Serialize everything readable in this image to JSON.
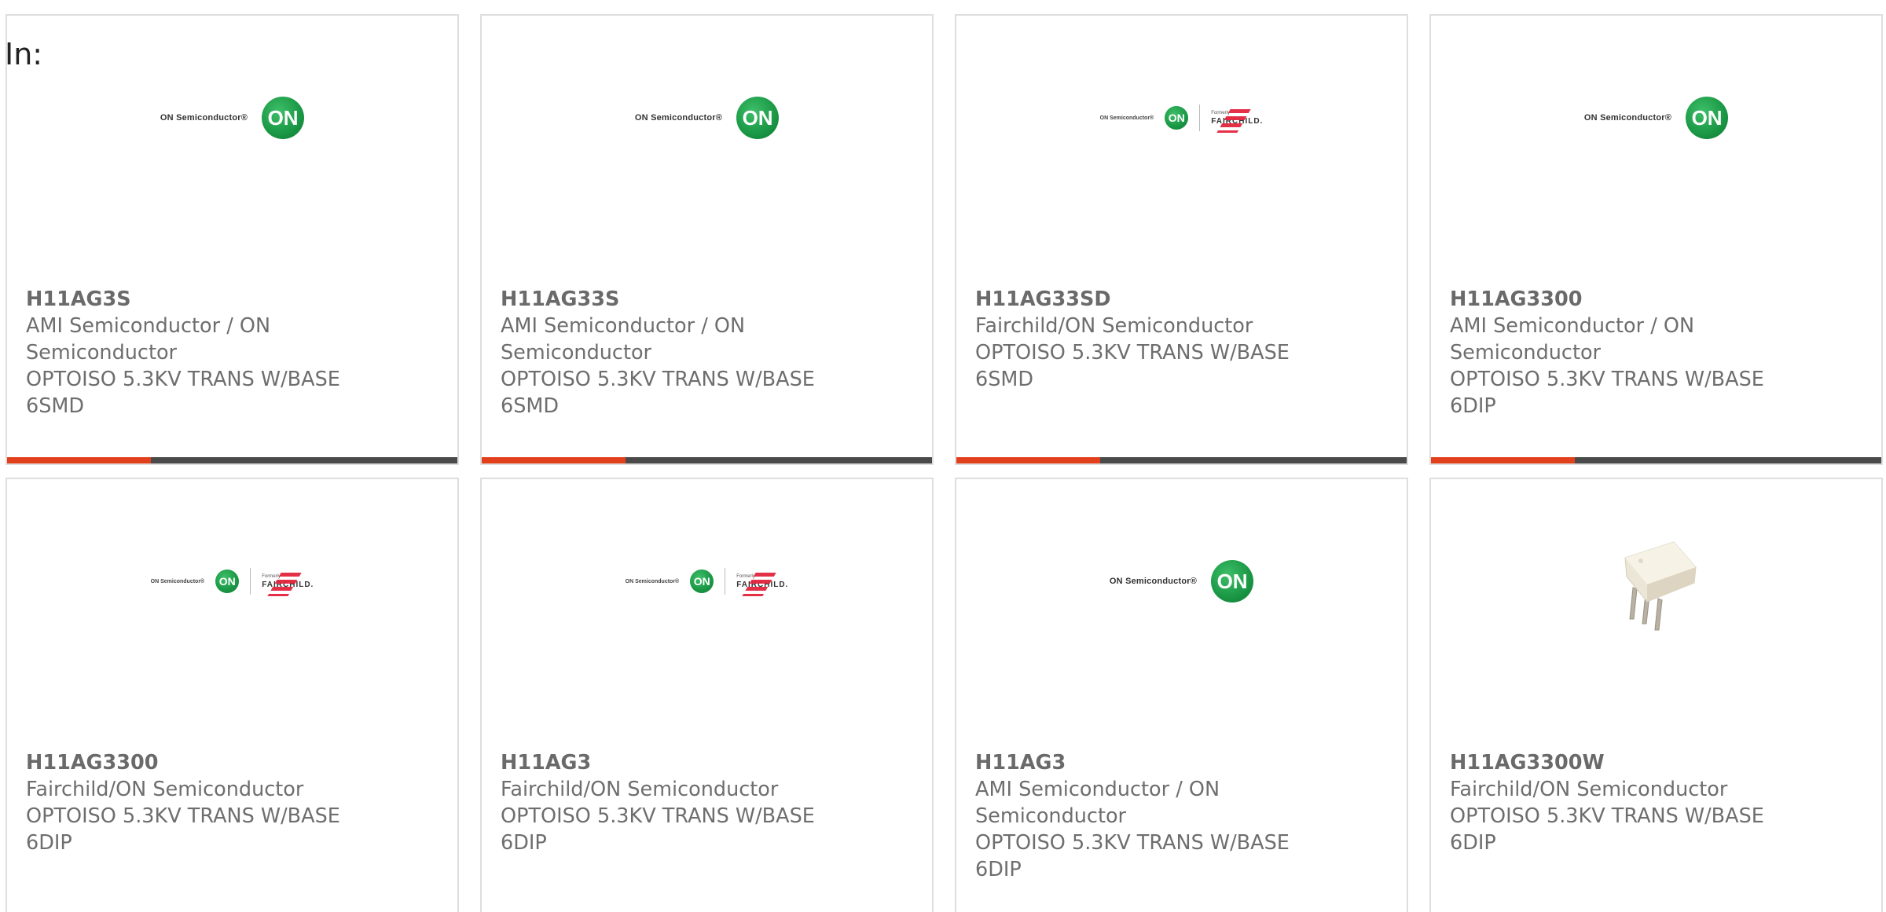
{
  "heading": "In:",
  "colors": {
    "accent_bar": "#e2401c",
    "bar": "#4a4a4a",
    "on_green": "#1c9a47",
    "fairchild_red": "#e2253c"
  },
  "logo_text": {
    "on_semiconductor": "ON Semiconductor®",
    "on_badge": "ON",
    "formerly": "Formerly",
    "fairchild": "FAIRCHILD."
  },
  "cards": [
    {
      "part_number": "H11AG3S",
      "manufacturer": "AMI Semiconductor / ON Semiconductor",
      "description": "OPTOISO 5.3KV TRANS W/BASE 6SMD",
      "image": "on-semiconductor-logo"
    },
    {
      "part_number": "H11AG33S",
      "manufacturer": "AMI Semiconductor / ON Semiconductor",
      "description": "OPTOISO 5.3KV TRANS W/BASE 6SMD",
      "image": "on-semiconductor-logo"
    },
    {
      "part_number": "H11AG33SD",
      "manufacturer": "Fairchild/ON Semiconductor",
      "description": "OPTOISO 5.3KV TRANS W/BASE 6SMD",
      "image": "on-fairchild-logo"
    },
    {
      "part_number": "H11AG3300",
      "manufacturer": "AMI Semiconductor / ON Semiconductor",
      "description": "OPTOISO 5.3KV TRANS W/BASE 6DIP",
      "image": "on-semiconductor-logo"
    },
    {
      "part_number": "H11AG3300",
      "manufacturer": "Fairchild/ON Semiconductor",
      "description": "OPTOISO 5.3KV TRANS W/BASE 6DIP",
      "image": "on-fairchild-logo"
    },
    {
      "part_number": "H11AG3",
      "manufacturer": "Fairchild/ON Semiconductor",
      "description": "OPTOISO 5.3KV TRANS W/BASE 6DIP",
      "image": "on-fairchild-logo"
    },
    {
      "part_number": "H11AG3",
      "manufacturer": "AMI Semiconductor / ON Semiconductor",
      "description": "OPTOISO 5.3KV TRANS W/BASE 6DIP",
      "image": "on-semiconductor-logo"
    },
    {
      "part_number": "H11AG3300W",
      "manufacturer": "Fairchild/ON Semiconductor",
      "description": "OPTOISO 5.3KV TRANS W/BASE 6DIP",
      "image": "dip6-chip-photo"
    }
  ]
}
